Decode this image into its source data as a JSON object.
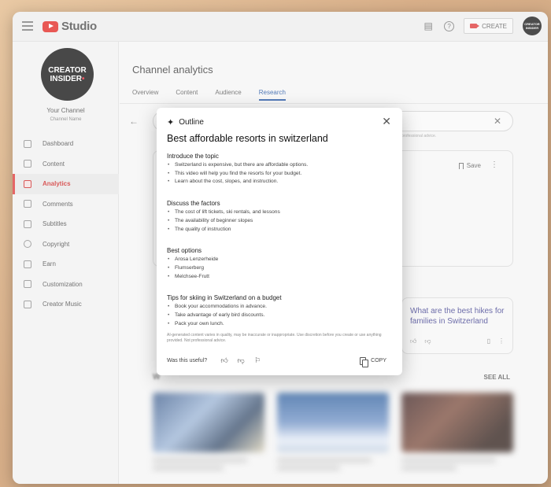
{
  "app": {
    "logo_text": "Studio"
  },
  "topbar": {
    "create_label": "CREATE",
    "avatar_text": "CREATOR INSIDER"
  },
  "sidebar": {
    "avatar_line1": "CREATOR",
    "avatar_line2": "INSIDER",
    "your_channel": "Your Channel",
    "channel_name": "Channel Name",
    "items": [
      {
        "label": "Dashboard"
      },
      {
        "label": "Content"
      },
      {
        "label": "Analytics",
        "active": true
      },
      {
        "label": "Comments"
      },
      {
        "label": "Subtitles"
      },
      {
        "label": "Copyright"
      },
      {
        "label": "Earn"
      },
      {
        "label": "Customization"
      },
      {
        "label": "Creator Music"
      }
    ]
  },
  "main": {
    "title": "Channel analytics",
    "tabs": [
      {
        "label": "Overview"
      },
      {
        "label": "Content"
      },
      {
        "label": "Audience"
      },
      {
        "label": "Research",
        "active": true
      }
    ],
    "hint": "professional advice.",
    "save_label": "Save",
    "suggestion_question": "What are the best hikes for families in Switzerland",
    "see_all": "SEE ALL",
    "section_letter": "W"
  },
  "modal": {
    "header": "Outline",
    "title": "Best affordable resorts in switzerland",
    "sections": [
      {
        "title": "Introduce the topic",
        "bullets": [
          "Switzerland is expensive, but there are affordable options.",
          "This video will help you find the resorts for your budget.",
          "Learn about the cost, slopes, and instruction."
        ]
      },
      {
        "title": "Discuss the factors",
        "bullets": [
          "The cost of lift tickets, ski rentals, and lessons",
          "The availability of beginner slopes",
          "The quality of instruction"
        ]
      },
      {
        "title": "Best options",
        "bullets": [
          "Arosa Lenzerheide",
          "Flumserberg",
          "Melchsee-Frutt"
        ]
      },
      {
        "title": "Tips for skiing in Switzerland on a budget",
        "bullets": [
          "Book your accommodations in advance.",
          "Take advantage of early bird discounts.",
          "Pack your own lunch."
        ]
      }
    ],
    "disclaimer": "AI-generated content varies in quality, may be inaccurate or inappropriate. Use discretion before you create or use anything provided. Not professional advice.",
    "useful_label": "Was this useful?",
    "copy_label": "COPY"
  },
  "colors": {
    "accent_red": "#e0201b",
    "research_tab": "#1a4fa0",
    "question_text": "#3a3a8c"
  }
}
